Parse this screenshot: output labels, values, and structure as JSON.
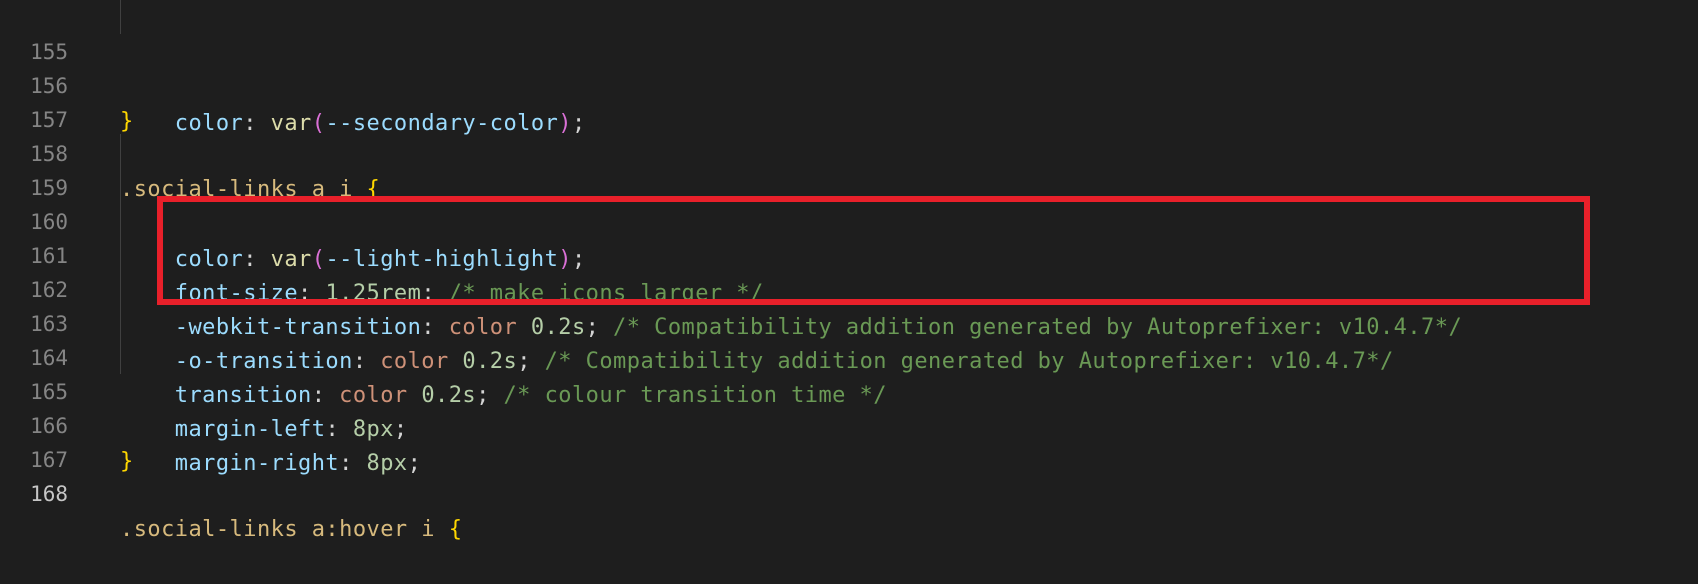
{
  "editor": {
    "current_line": "168",
    "lines": [
      {
        "num": "155",
        "indent": "    ",
        "tokens": [
          "color",
          ": ",
          "var",
          "(",
          "--secondary-color",
          ")",
          ";"
        ]
      },
      {
        "num": "156",
        "indent": "",
        "tokens": [
          "}"
        ]
      },
      {
        "num": "157",
        "indent": "",
        "tokens": []
      },
      {
        "num": "158",
        "indent": "",
        "tokens": [
          ".social-links a i",
          " ",
          "{"
        ]
      },
      {
        "num": "159",
        "indent": "    ",
        "tokens": [
          "color",
          ": ",
          "var",
          "(",
          "--light-highlight",
          ")",
          ";"
        ]
      },
      {
        "num": "160",
        "indent": "    ",
        "tokens": [
          "font-size",
          ": ",
          "1.25rem",
          "; ",
          "/* make icons larger */"
        ]
      },
      {
        "num": "161",
        "indent": "    ",
        "tokens": [
          "-webkit-transition",
          ": ",
          "color",
          " ",
          "0.2s",
          "; ",
          "/* Compatibility addition generated by Autoprefixer: v10.4.7*/"
        ]
      },
      {
        "num": "162",
        "indent": "    ",
        "tokens": [
          "-o-transition",
          ": ",
          "color",
          " ",
          "0.2s",
          "; ",
          "/* Compatibility addition generated by Autoprefixer: v10.4.7*/"
        ]
      },
      {
        "num": "163",
        "indent": "    ",
        "tokens": [
          "transition",
          ": ",
          "color",
          " ",
          "0.2s",
          "; ",
          "/* colour transition time */"
        ]
      },
      {
        "num": "164",
        "indent": "    ",
        "tokens": [
          "margin-left",
          ": ",
          "8px",
          ";"
        ]
      },
      {
        "num": "165",
        "indent": "    ",
        "tokens": [
          "margin-right",
          ": ",
          "8px",
          ";"
        ]
      },
      {
        "num": "166",
        "indent": "",
        "tokens": [
          "}"
        ]
      },
      {
        "num": "167",
        "indent": "",
        "tokens": []
      },
      {
        "num": "168",
        "indent": "",
        "tokens": [
          ".social-links a:hover i",
          " ",
          "{"
        ]
      }
    ]
  },
  "annotation": {
    "color": "#e8202a"
  }
}
